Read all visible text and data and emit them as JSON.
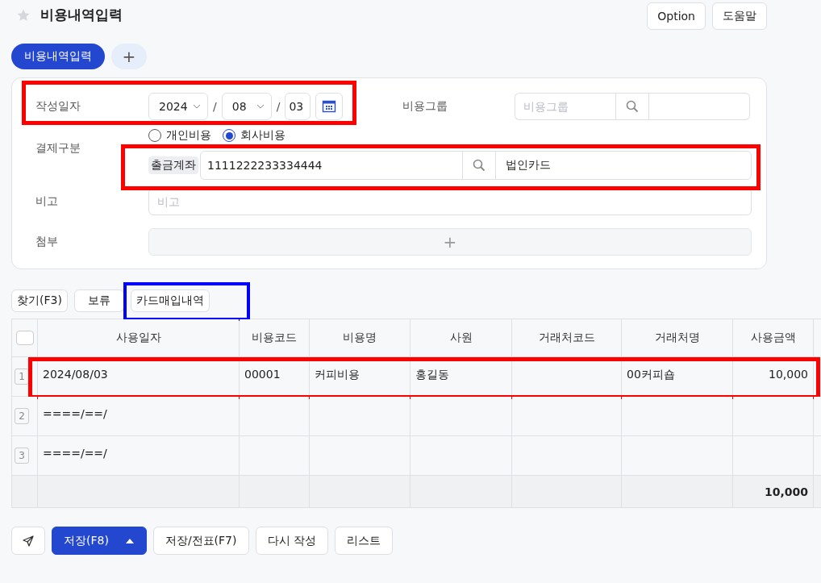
{
  "page": {
    "title": "비용내역입력",
    "favorite": false
  },
  "header_buttons": [
    "Option",
    "도움말"
  ],
  "tabs": [
    {
      "label": "비용내역입력",
      "selected": true
    }
  ],
  "add_tab": "+",
  "form": {
    "date": {
      "label": "작성일자",
      "year": "2024",
      "month": "08",
      "day": "03",
      "separators": [
        "/",
        "/"
      ],
      "highlight": {
        "color": "#ff0000"
      }
    },
    "expense_group": {
      "label": "비용그룹",
      "placeholder": "비용그룹"
    },
    "payment": {
      "label": "결제구분",
      "options": [
        {
          "label": "개인비용",
          "selected": false
        },
        {
          "label": "회사비용",
          "selected": true
        }
      ],
      "account_tag": "출금계좌",
      "account_number": "1111222233334444",
      "account_name": "법인카드",
      "highlight": {
        "color": "#ff0000"
      }
    },
    "memo": {
      "label": "비고",
      "placeholder": "비고"
    },
    "attachment": {
      "label": "첨부",
      "add": "+"
    }
  },
  "toolbar": [
    {
      "label": "찾기(F3)"
    },
    {
      "label": "보류"
    },
    {
      "label": "카드매입내역",
      "highlight": {
        "color": "#0000ff"
      }
    }
  ],
  "table": {
    "select_all": false,
    "columns": [
      "사용일자",
      "비용코드",
      "비용명",
      "사원",
      "거래처코드",
      "거래처명",
      "사용금액"
    ],
    "rows": [
      {
        "number": "1",
        "date": "2024/08/03",
        "code": "00001",
        "name": "커피비용",
        "employee": "홍길동",
        "partner_name": "00커피숍",
        "amount": "10,000",
        "highlight": {
          "color": "#ff0000"
        }
      },
      {
        "number": "2",
        "date": "====/==/"
      },
      {
        "number": "3",
        "date": "====/==/"
      }
    ],
    "total": "10,000"
  },
  "footer_buttons": [
    {
      "kind": "send"
    },
    {
      "kind": "primary",
      "label": "저장(F8)"
    },
    {
      "kind": "plain",
      "label": "저장/전표(F7)"
    },
    {
      "kind": "plain",
      "label": "다시 작성"
    },
    {
      "kind": "plain",
      "label": "리스트"
    }
  ]
}
